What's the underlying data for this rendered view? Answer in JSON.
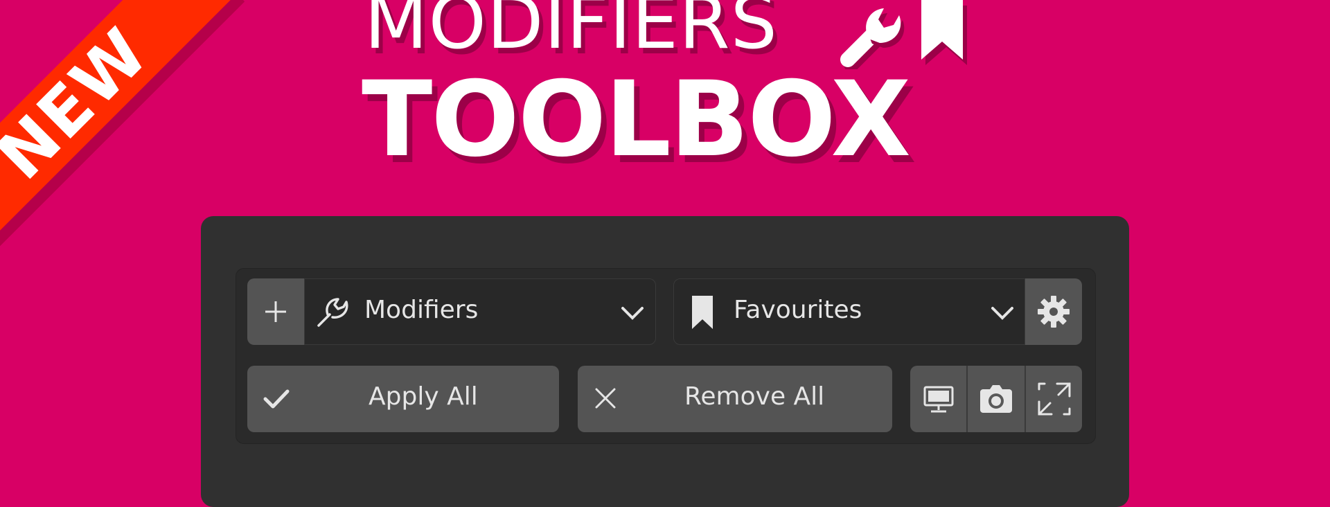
{
  "ribbon": {
    "text": "NEW"
  },
  "title": {
    "line1": "MODIFIERS",
    "line2": "TOOLBOX"
  },
  "logo_icons": [
    "wrench-icon",
    "bookmark-icon"
  ],
  "toolbar": {
    "add_icon": "plus-icon",
    "modifiers_dropdown": {
      "icon": "wrench-icon",
      "label": "Modifiers",
      "chevron": "chevron-down-icon"
    },
    "favourites_dropdown": {
      "icon": "bookmark-icon",
      "label": "Favourites",
      "chevron": "chevron-down-icon"
    },
    "settings_icon": "gear-icon",
    "apply_all": {
      "icon": "checkmark-icon",
      "label": "Apply All"
    },
    "remove_all": {
      "icon": "close-icon",
      "label": "Remove All"
    },
    "toggles": [
      "monitor-icon",
      "camera-icon",
      "expand-icon"
    ]
  },
  "colors": {
    "background": "#d80065",
    "ribbon": "#ff2a00",
    "panel": "#303030",
    "button": "#545454",
    "text": "#e6e6e6"
  }
}
